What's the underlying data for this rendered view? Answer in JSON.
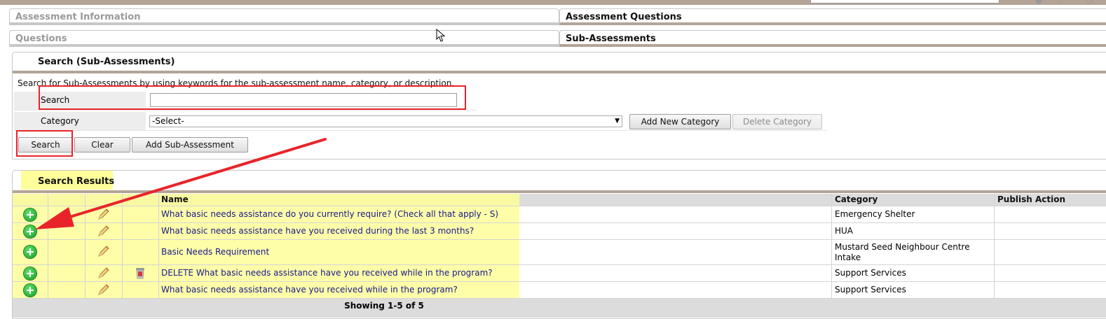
{
  "tabs_row1": [
    {
      "label": "Assessment Information",
      "active": false
    },
    {
      "label": "Assessment Questions",
      "active": true
    }
  ],
  "tabs_row2": [
    {
      "label": "Questions",
      "active": false
    },
    {
      "label": "Sub-Assessments",
      "active": true
    }
  ],
  "search_panel": {
    "title": "Search (Sub-Assessments)",
    "description": "Search for Sub-Assessments by using keywords for the sub-assessment name, category, or description.",
    "search_label": "Search",
    "search_value": "",
    "category_label": "Category",
    "category_selected": "-Select-",
    "add_category_label": "Add New Category",
    "delete_category_label": "Delete Category",
    "search_button": "Search",
    "clear_button": "Clear",
    "add_sub_button": "Add Sub-Assessment"
  },
  "results": {
    "title": "Search Results",
    "columns": {
      "name": "Name",
      "category": "Category",
      "publish": "Publish Action"
    },
    "rows": [
      {
        "name": "What basic needs assistance do you currently require? (Check all that apply - S)",
        "category": "Emergency Shelter",
        "trash": false
      },
      {
        "name": "What basic needs assistance have you received during the last 3 months?",
        "category": "HUA",
        "trash": false
      },
      {
        "name": "Basic Needs Requirement",
        "category": "Mustard Seed Neighbour Centre Intake",
        "trash": false
      },
      {
        "name": "DELETE What basic needs assistance have you received while in the program?",
        "category": "Support Services",
        "trash": true
      },
      {
        "name": "What basic needs assistance have you received while in the program?",
        "category": "Support Services",
        "trash": false
      }
    ],
    "footer": "Showing 1-5 of 5"
  },
  "icons": {
    "add": "add-circle-icon",
    "edit": "pencil-icon",
    "delete": "trash-icon",
    "cursor": "mouse-pointer-icon",
    "annotation": "red-arrow-annotation"
  },
  "colors": {
    "accent_brown": "#b4a496",
    "annotation_red": "#e8242a",
    "highlight_yellow": "#fefe9a",
    "link_blue": "#17178a"
  }
}
